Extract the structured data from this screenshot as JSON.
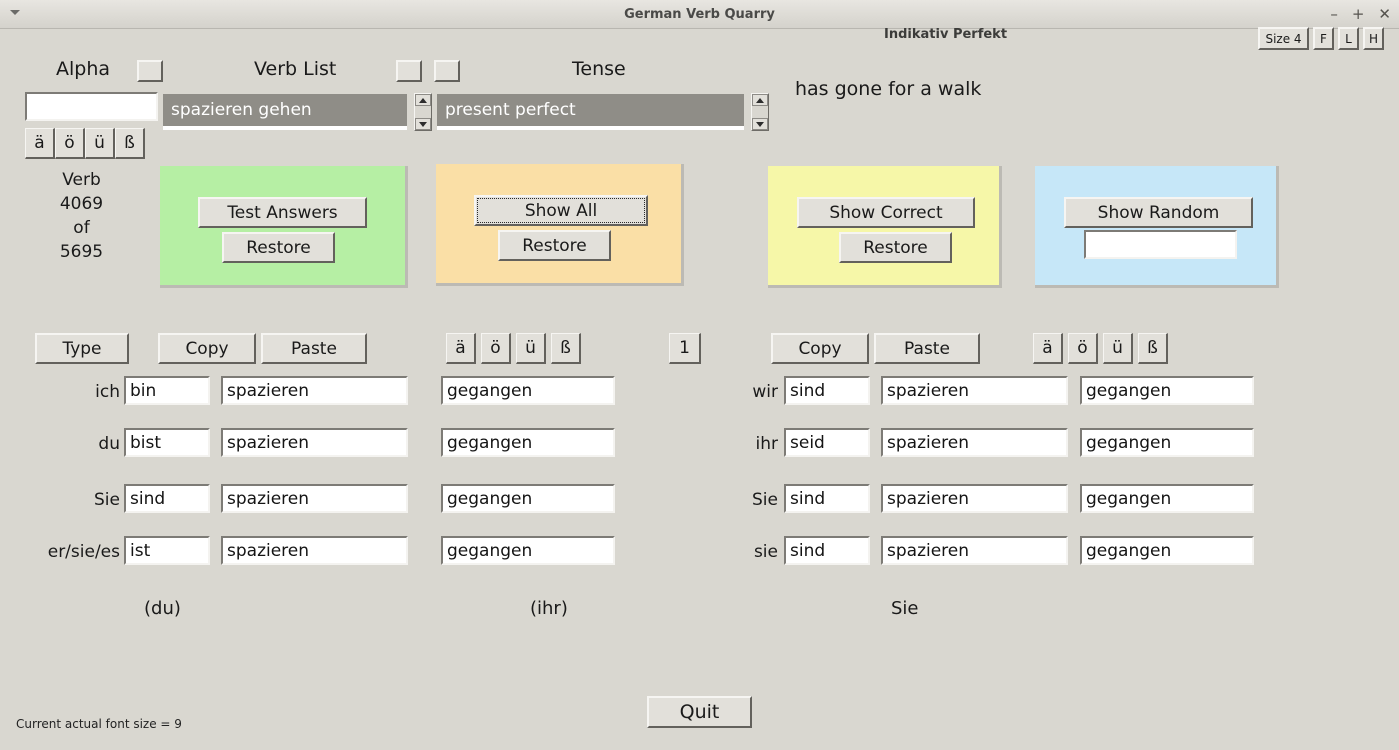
{
  "window": {
    "title": "German Verb Quarry",
    "menu_caret": "menu-caret",
    "minimize": "–",
    "maximize": "+",
    "close": "✕"
  },
  "top_right_buttons": [
    {
      "name": "size-button",
      "label": "Size 4"
    },
    {
      "name": "f-button",
      "label": "F"
    },
    {
      "name": "l-button",
      "label": "L"
    },
    {
      "name": "h-button",
      "label": "H"
    }
  ],
  "header": {
    "mood_tense": "Indikativ Perfekt",
    "translation": "has gone for a walk"
  },
  "alpha": {
    "label": "Alpha",
    "checkbox": "",
    "input_value": "",
    "umlaut_buttons": [
      "ä",
      "ö",
      "ü",
      "ß"
    ]
  },
  "verb_counter": {
    "line1": "Verb",
    "line2": "4069",
    "line3": "of",
    "line4": "5695"
  },
  "verb_list": {
    "label": "Verb List",
    "checkbox_1": "",
    "checkbox_2": "",
    "selected": "spazieren gehen"
  },
  "tense": {
    "label": "Tense",
    "selected": "present perfect"
  },
  "panels": [
    {
      "name": "test-answers-panel",
      "color": "#b6efa4",
      "primary": "Test Answers",
      "secondary": "Restore",
      "primary_focused": false,
      "has_entry": false
    },
    {
      "name": "show-all-panel",
      "color": "#fadfa6",
      "primary": "Show All",
      "secondary": "Restore",
      "primary_focused": true,
      "has_entry": false
    },
    {
      "name": "show-correct-panel",
      "color": "#f6f7a8",
      "primary": "Show Correct",
      "secondary": "Restore",
      "primary_focused": false,
      "has_entry": false
    },
    {
      "name": "show-random-panel",
      "color": "#c6e7f8",
      "primary": "Show Random",
      "secondary": "",
      "primary_focused": false,
      "has_entry": true,
      "entry_value": ""
    }
  ],
  "toolbar_left": {
    "type_label": "Type",
    "copy_label": "Copy",
    "paste_label": "Paste",
    "umlauts": [
      "ä",
      "ö",
      "ü",
      "ß"
    ],
    "counter_label": "1"
  },
  "toolbar_right": {
    "copy_label": "Copy",
    "paste_label": "Paste",
    "umlauts": [
      "ä",
      "ö",
      "ü",
      "ß"
    ]
  },
  "conjugation_left": [
    {
      "pronoun": "ich",
      "aux": "bin",
      "verb": "spazieren",
      "participle": "gegangen"
    },
    {
      "pronoun": "du",
      "aux": "bist",
      "verb": "spazieren",
      "participle": "gegangen"
    },
    {
      "pronoun": "Sie",
      "aux": "sind",
      "verb": "spazieren",
      "participle": "gegangen"
    },
    {
      "pronoun": "er/sie/es",
      "aux": "ist",
      "verb": "spazieren",
      "participle": "gegangen"
    }
  ],
  "conjugation_right": [
    {
      "pronoun": "wir",
      "aux": "sind",
      "verb": "spazieren",
      "participle": "gegangen"
    },
    {
      "pronoun": "ihr",
      "aux": "seid",
      "verb": "spazieren",
      "participle": "gegangen"
    },
    {
      "pronoun": "Sie",
      "aux": "sind",
      "verb": "spazieren",
      "participle": "gegangen"
    },
    {
      "pronoun": "sie",
      "aux": "sind",
      "verb": "spazieren",
      "participle": "gegangen"
    }
  ],
  "imperatives": [
    {
      "name": "imperative-du",
      "label": "(du)"
    },
    {
      "name": "imperative-ihr",
      "label": "(ihr)"
    },
    {
      "name": "imperative-sie",
      "label": "Sie"
    }
  ],
  "footer": {
    "font_size_status": "Current actual font size = 9",
    "quit_label": "Quit"
  }
}
